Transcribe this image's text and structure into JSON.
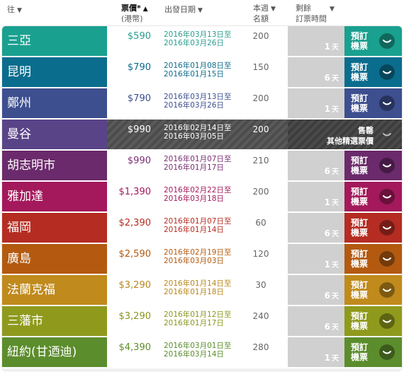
{
  "header": {
    "dest": "往",
    "price": "票價*",
    "currency": "(港幣)",
    "dates": "出發日期",
    "seats_line1": "本週",
    "seats_line2": "名額",
    "remain_line1": "剩餘",
    "remain_line2": "訂票時間",
    "sort_arrow": "▼",
    "sort_arrow_active": "▲"
  },
  "book_label": "預訂機票",
  "day_unit": "天",
  "soldout_line1": "售罄",
  "soldout_line2": "其他精選票價",
  "rows": [
    {
      "dest": "三亞",
      "price": "$590",
      "date1": "2016年03月13日至",
      "date2": "2016年03月26日",
      "seats": "200",
      "days": "1",
      "color": "#1aa08f",
      "price_color": "#2a9d8f",
      "date_color": "#2a9d8f",
      "soldout": false
    },
    {
      "dest": "昆明",
      "price": "$790",
      "date1": "2016年01月08日至",
      "date2": "2016年01月15日",
      "seats": "150",
      "days": "6",
      "color": "#0b6d8e",
      "price_color": "#0d6b8c",
      "date_color": "#0d6b8c",
      "soldout": false
    },
    {
      "dest": "鄭州",
      "price": "$790",
      "date1": "2016年03月13日至",
      "date2": "2016年03月26日",
      "seats": "200",
      "days": "1",
      "color": "#3d4f8f",
      "price_color": "#3d4f8f",
      "date_color": "#3d4f8f",
      "soldout": false
    },
    {
      "dest": "曼谷",
      "price": "$990",
      "date1": "2016年02月14日至",
      "date2": "2016年03月05日",
      "seats": "200",
      "days": "",
      "color": "#5a4488",
      "price_color": "#ffffff",
      "date_color": "#ffffff",
      "soldout": true
    },
    {
      "dest": "胡志明市",
      "price": "$990",
      "date1": "2016年01月07日至",
      "date2": "2016年01月17日",
      "seats": "210",
      "days": "6",
      "color": "#6b2a6b",
      "price_color": "#7a2f72",
      "date_color": "#7a2f72",
      "soldout": false
    },
    {
      "dest": "雅加達",
      "price": "$1,390",
      "date1": "2016年02月22日至",
      "date2": "2016年03月18日",
      "seats": "200",
      "days": "1",
      "color": "#a3195b",
      "price_color": "#a3195b",
      "date_color": "#a3195b",
      "soldout": false
    },
    {
      "dest": "福岡",
      "price": "$2,390",
      "date1": "2016年01月07日至",
      "date2": "2016年01月14日",
      "seats": "60",
      "days": "6",
      "color": "#b52c22",
      "price_color": "#b52c22",
      "date_color": "#b52c22",
      "soldout": false
    },
    {
      "dest": "廣島",
      "price": "$2,590",
      "date1": "2016年02月19日至",
      "date2": "2016年03月03日",
      "seats": "120",
      "days": "1",
      "color": "#b35a10",
      "price_color": "#b35a10",
      "date_color": "#b35a10",
      "soldout": false
    },
    {
      "dest": "法蘭克福",
      "price": "$3,290",
      "date1": "2016年01月14日至",
      "date2": "2016年01月18日",
      "seats": "30",
      "days": "6",
      "color": "#c08a1c",
      "price_color": "#b8871c",
      "date_color": "#b8871c",
      "soldout": false
    },
    {
      "dest": "三藩市",
      "price": "$3,290",
      "date1": "2016年01月12日至",
      "date2": "2016年01月17日",
      "seats": "240",
      "days": "6",
      "color": "#8f9a1d",
      "price_color": "#8b961d",
      "date_color": "#8b961d",
      "soldout": false
    },
    {
      "dest": "紐約(甘迺迪)",
      "price": "$4,390",
      "date1": "2016年03月01日至",
      "date2": "2016年03月14日",
      "seats": "280",
      "days": "1",
      "color": "#5c8d2c",
      "price_color": "#5c8d2c",
      "date_color": "#5c8d2c",
      "soldout": false
    }
  ]
}
